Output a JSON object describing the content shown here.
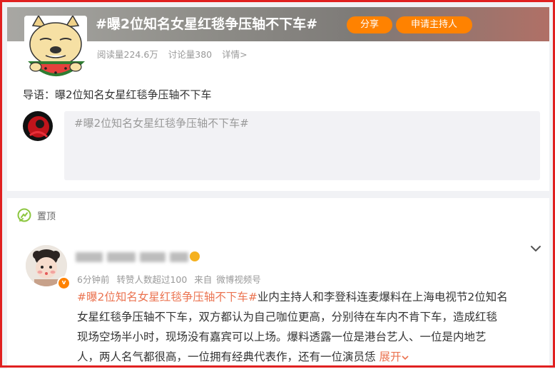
{
  "topic": {
    "title": "#曝2位知名女星红毯争压轴不下车#",
    "share_label": "分享",
    "host_label": "申请主持人",
    "reads": "阅读量224.6万",
    "discussions": "讨论量380",
    "detail_link": "详情>",
    "intro": "导语：曝2位知名女星红毯争压轴不下车",
    "compose_placeholder": "#曝2位知名女星红毯争压轴不下车#"
  },
  "post": {
    "pin_label": "置顶",
    "time": "6分钟前",
    "reposts": "转赞人数超过100",
    "source_prefix": "来自",
    "source": "微博视频号",
    "hashtag": "#曝2位知名女星红毯争压轴不下车#",
    "line1_text": "业内主持人和李登科连麦爆料在上海电视节2位知名",
    "line2": "女星红毯争压轴不下车，双方都认为自己咖位更高，分别待在车内不肯下车，造成红毯",
    "line3": "现场空场半小时，现场没有嘉宾可以上场。爆料透露一位是港台艺人、一位是内地艺",
    "line4": "人，两人名气都很高，一位拥有经典代表作，还有一位演员恁",
    "expand_label": "展开",
    "vip_mark": "v"
  },
  "icons": {
    "pin": "pin-icon",
    "chevron": "chevron-down-icon",
    "expand": "chevron-down-icon"
  },
  "colors": {
    "accent": "#ff8200",
    "hashtag": "#eb7350",
    "frame": "#e02020"
  }
}
